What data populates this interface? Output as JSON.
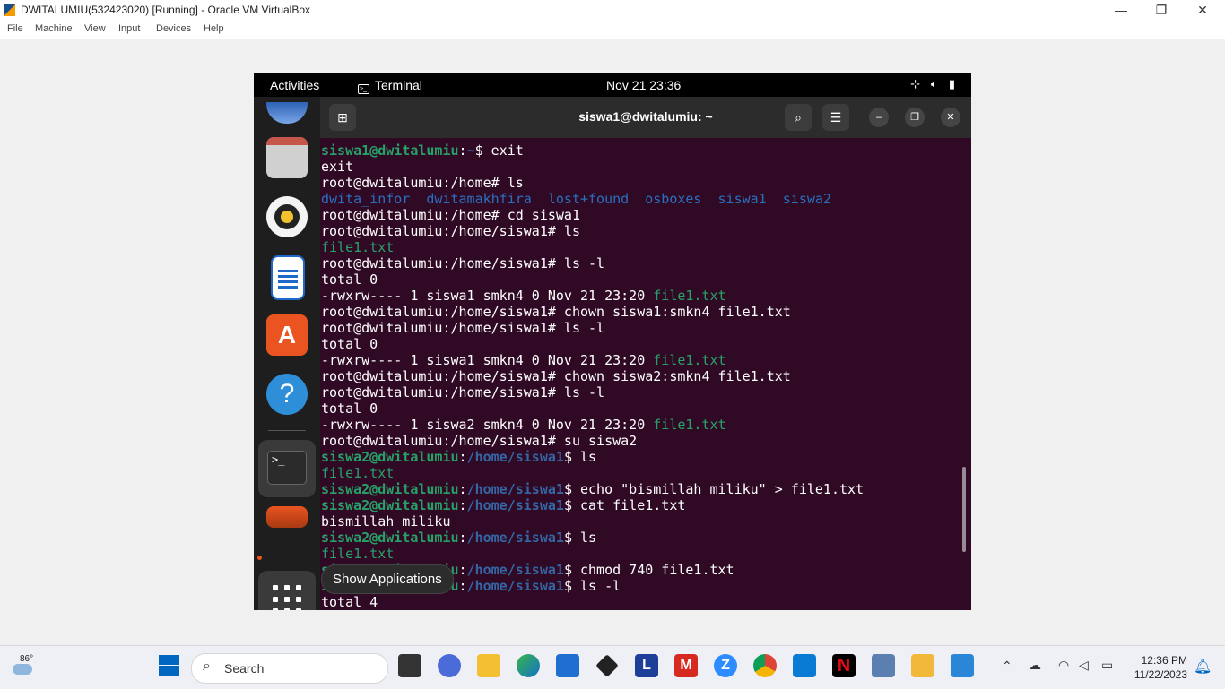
{
  "vbox": {
    "title": "DWITALUMIU(532423020) [Running] - Oracle VM VirtualBox",
    "menu": [
      "File",
      "Machine",
      "View",
      "Input",
      "Devices",
      "Help"
    ],
    "controls": {
      "minimize": "—",
      "restore": "❐",
      "close": "✕"
    }
  },
  "guest": {
    "topbar": {
      "activities": "Activities",
      "app": "Terminal",
      "clock": "Nov 21  23:36",
      "tray_icons": [
        "network-icon",
        "volume-icon",
        "battery-icon"
      ]
    },
    "dock": {
      "items": [
        "thunderbird",
        "files",
        "rhythmbox",
        "libreoffice-writer",
        "app-center",
        "help",
        "terminal",
        "ubuntu-software"
      ],
      "tooltip": "Show Applications"
    },
    "terminal": {
      "title": "siswa1@dwitalumiu: ~",
      "lines": [
        [
          {
            "t": "siswa1@dwitalumiu",
            "c": "u"
          },
          {
            "t": ":"
          },
          {
            "t": "~",
            "c": "p"
          },
          {
            "t": "$ exit"
          }
        ],
        [
          {
            "t": "exit"
          }
        ],
        [
          {
            "t": "root@dwitalumiu:/home# ls"
          }
        ],
        [
          {
            "t": "dwita_infor",
            "c": "d"
          },
          {
            "t": "  "
          },
          {
            "t": "dwitamakhfira",
            "c": "d"
          },
          {
            "t": "  "
          },
          {
            "t": "lost+found",
            "c": "d"
          },
          {
            "t": "  "
          },
          {
            "t": "osboxes",
            "c": "d"
          },
          {
            "t": "  "
          },
          {
            "t": "siswa1",
            "c": "d"
          },
          {
            "t": "  "
          },
          {
            "t": "siswa2",
            "c": "d"
          }
        ],
        [
          {
            "t": "root@dwitalumiu:/home# cd siswa1"
          }
        ],
        [
          {
            "t": "root@dwitalumiu:/home/siswa1# ls"
          }
        ],
        [
          {
            "t": "file1.txt",
            "c": "g"
          }
        ],
        [
          {
            "t": "root@dwitalumiu:/home/siswa1# ls -l"
          }
        ],
        [
          {
            "t": "total 0"
          }
        ],
        [
          {
            "t": "-rwxrw---- 1 siswa1 smkn4 0 Nov 21 23:20 "
          },
          {
            "t": "file1.txt",
            "c": "g"
          }
        ],
        [
          {
            "t": "root@dwitalumiu:/home/siswa1# chown siswa1:smkn4 file1.txt"
          }
        ],
        [
          {
            "t": "root@dwitalumiu:/home/siswa1# ls -l"
          }
        ],
        [
          {
            "t": "total 0"
          }
        ],
        [
          {
            "t": "-rwxrw---- 1 siswa1 smkn4 0 Nov 21 23:20 "
          },
          {
            "t": "file1.txt",
            "c": "g"
          }
        ],
        [
          {
            "t": "root@dwitalumiu:/home/siswa1# chown siswa2:smkn4 file1.txt"
          }
        ],
        [
          {
            "t": "root@dwitalumiu:/home/siswa1# ls -l"
          }
        ],
        [
          {
            "t": "total 0"
          }
        ],
        [
          {
            "t": "-rwxrw---- 1 siswa2 smkn4 0 Nov 21 23:20 "
          },
          {
            "t": "file1.txt",
            "c": "g"
          }
        ],
        [
          {
            "t": "root@dwitalumiu:/home/siswa1# su siswa2"
          }
        ],
        [
          {
            "t": "siswa2@dwitalumiu",
            "c": "u"
          },
          {
            "t": ":"
          },
          {
            "t": "/home/siswa1",
            "c": "p"
          },
          {
            "t": "$ ls"
          }
        ],
        [
          {
            "t": "file1.txt",
            "c": "g"
          }
        ],
        [
          {
            "t": "siswa2@dwitalumiu",
            "c": "u"
          },
          {
            "t": ":"
          },
          {
            "t": "/home/siswa1",
            "c": "p"
          },
          {
            "t": "$ echo \"bismillah miliku\" > file1.txt"
          }
        ],
        [
          {
            "t": "siswa2@dwitalumiu",
            "c": "u"
          },
          {
            "t": ":"
          },
          {
            "t": "/home/siswa1",
            "c": "p"
          },
          {
            "t": "$ cat file1.txt"
          }
        ],
        [
          {
            "t": "bismillah miliku"
          }
        ],
        [
          {
            "t": "siswa2@dwitalumiu",
            "c": "u"
          },
          {
            "t": ":"
          },
          {
            "t": "/home/siswa1",
            "c": "p"
          },
          {
            "t": "$ ls"
          }
        ],
        [
          {
            "t": "file1.txt",
            "c": "g"
          }
        ],
        [
          {
            "t": "siswa2@dwitalumiu",
            "c": "u"
          },
          {
            "t": ":"
          },
          {
            "t": "/home/siswa1",
            "c": "p"
          },
          {
            "t": "$ chmod 740 file1.txt"
          }
        ],
        [
          {
            "t": "siswa2@dwitalumiu",
            "c": "u"
          },
          {
            "t": ":"
          },
          {
            "t": "/home/siswa1",
            "c": "p"
          },
          {
            "t": "$ ls -l"
          }
        ],
        [
          {
            "t": "total 4"
          }
        ]
      ]
    }
  },
  "taskbar": {
    "weather_temp": "86°",
    "search_placeholder": "Search",
    "time": "12:36 PM",
    "date": "11/22/2023",
    "apps": [
      "task-view",
      "meet",
      "file-explorer",
      "edge",
      "store",
      "dropbox",
      "l-app",
      "mcafee",
      "zoom",
      "chrome",
      "vscode",
      "netflix",
      "virtualbox",
      "paint",
      "photos"
    ],
    "colors": {
      "accent": "#0067c0"
    }
  }
}
